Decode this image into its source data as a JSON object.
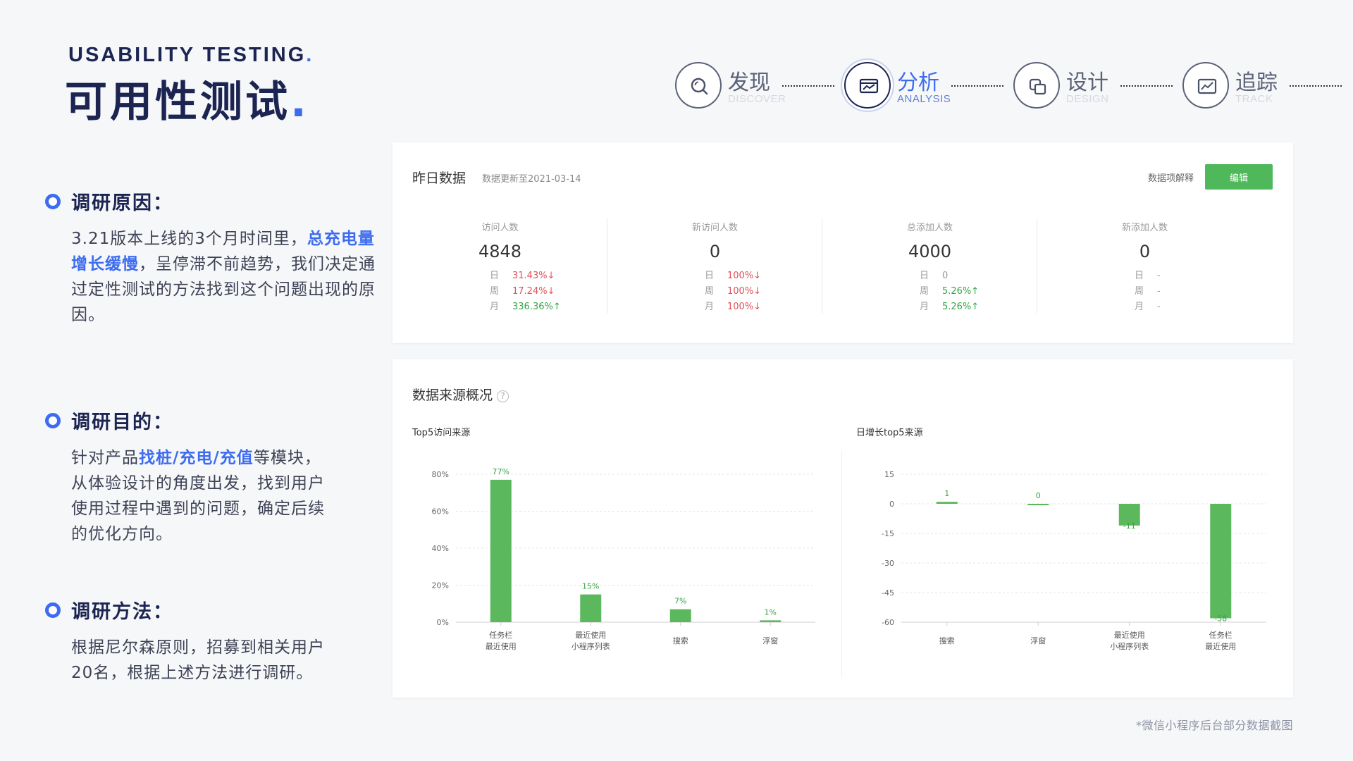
{
  "header": {
    "title_en": "USABILITY TESTING",
    "title_cn": "可用性测试",
    "dot": "."
  },
  "steps": [
    {
      "cn": "发现",
      "en": "DISCOVER",
      "icon": "search-icon",
      "active": false
    },
    {
      "cn": "分析",
      "en": "ANALYSIS",
      "icon": "analytics-icon",
      "active": true
    },
    {
      "cn": "设计",
      "en": "DESIGN",
      "icon": "layers-icon",
      "active": false
    },
    {
      "cn": "追踪",
      "en": "TRACK",
      "icon": "chart-icon",
      "active": false
    }
  ],
  "sections": {
    "reason": {
      "title": "调研原因：",
      "pre": "3.21版本上线的3个月时间里，",
      "hl": "总充电量增长缓慢",
      "post": "，呈停滞不前趋势，我们决定通过定性测试的方法找到这个问题出现的原因。"
    },
    "goal": {
      "title": "调研目的：",
      "pre": "针对产品",
      "hl": "找桩/充电/充值",
      "post": "等模块，从体验设计的角度出发，找到用户使用过程中遇到的问题，确定后续的优化方向。"
    },
    "method": {
      "title": "调研方法：",
      "pre": "根据尼尔森原则，招募到相关用户20名，根据上述方法进行调研。",
      "hl": "",
      "post": ""
    }
  },
  "yesterday": {
    "title": "昨日数据",
    "updated": "数据更新至2021-03-14",
    "explain_link": "数据项解释",
    "edit_label": "编辑",
    "metrics": [
      {
        "label": "访问人数",
        "value": "4848",
        "rows": [
          {
            "k": "日",
            "v": "31.43%↓",
            "tone": "red"
          },
          {
            "k": "周",
            "v": "17.24%↓",
            "tone": "red"
          },
          {
            "k": "月",
            "v": "336.36%↑",
            "tone": "green"
          }
        ]
      },
      {
        "label": "新访问人数",
        "value": "0",
        "rows": [
          {
            "k": "日",
            "v": "100%↓",
            "tone": "red"
          },
          {
            "k": "周",
            "v": "100%↓",
            "tone": "red"
          },
          {
            "k": "月",
            "v": "100%↓",
            "tone": "red"
          }
        ]
      },
      {
        "label": "总添加人数",
        "value": "4000",
        "rows": [
          {
            "k": "日",
            "v": "0",
            "tone": "gray"
          },
          {
            "k": "周",
            "v": "5.26%↑",
            "tone": "green"
          },
          {
            "k": "月",
            "v": "5.26%↑",
            "tone": "green"
          }
        ]
      },
      {
        "label": "新添加人数",
        "value": "0",
        "rows": [
          {
            "k": "日",
            "v": "-",
            "tone": "gray"
          },
          {
            "k": "周",
            "v": "-",
            "tone": "gray"
          },
          {
            "k": "月",
            "v": "-",
            "tone": "gray"
          }
        ]
      }
    ]
  },
  "sources": {
    "title": "数据来源概况",
    "help": "?"
  },
  "chart_data": [
    {
      "type": "bar",
      "title": "Top5访问来源",
      "categories": [
        [
          "任务栏",
          "最近使用"
        ],
        [
          "最近使用",
          "小程序列表"
        ],
        [
          "搜索"
        ],
        [
          "浮窗"
        ]
      ],
      "values": [
        77,
        15,
        7,
        1
      ],
      "value_labels": [
        "77%",
        "15%",
        "7%",
        "1%"
      ],
      "yticks": [
        "80%",
        "60%",
        "40%",
        "20%",
        "0%"
      ],
      "ylim": [
        0,
        80
      ],
      "grid": true,
      "color": "#5cb85c"
    },
    {
      "type": "bar",
      "title": "日增长top5来源",
      "categories": [
        [
          "搜索"
        ],
        [
          "浮窗"
        ],
        [
          "最近使用",
          "小程序列表"
        ],
        [
          "任务栏",
          "最近使用"
        ]
      ],
      "values": [
        1,
        0,
        -11,
        -58
      ],
      "value_labels": [
        "1",
        "0",
        "-11",
        "-58"
      ],
      "yticks": [
        "15",
        "0",
        "-15",
        "-30",
        "-45",
        "-60"
      ],
      "ylim": [
        -60,
        15
      ],
      "grid": true,
      "color": "#5cb85c"
    }
  ],
  "footnote": "*微信小程序后台部分数据截图"
}
